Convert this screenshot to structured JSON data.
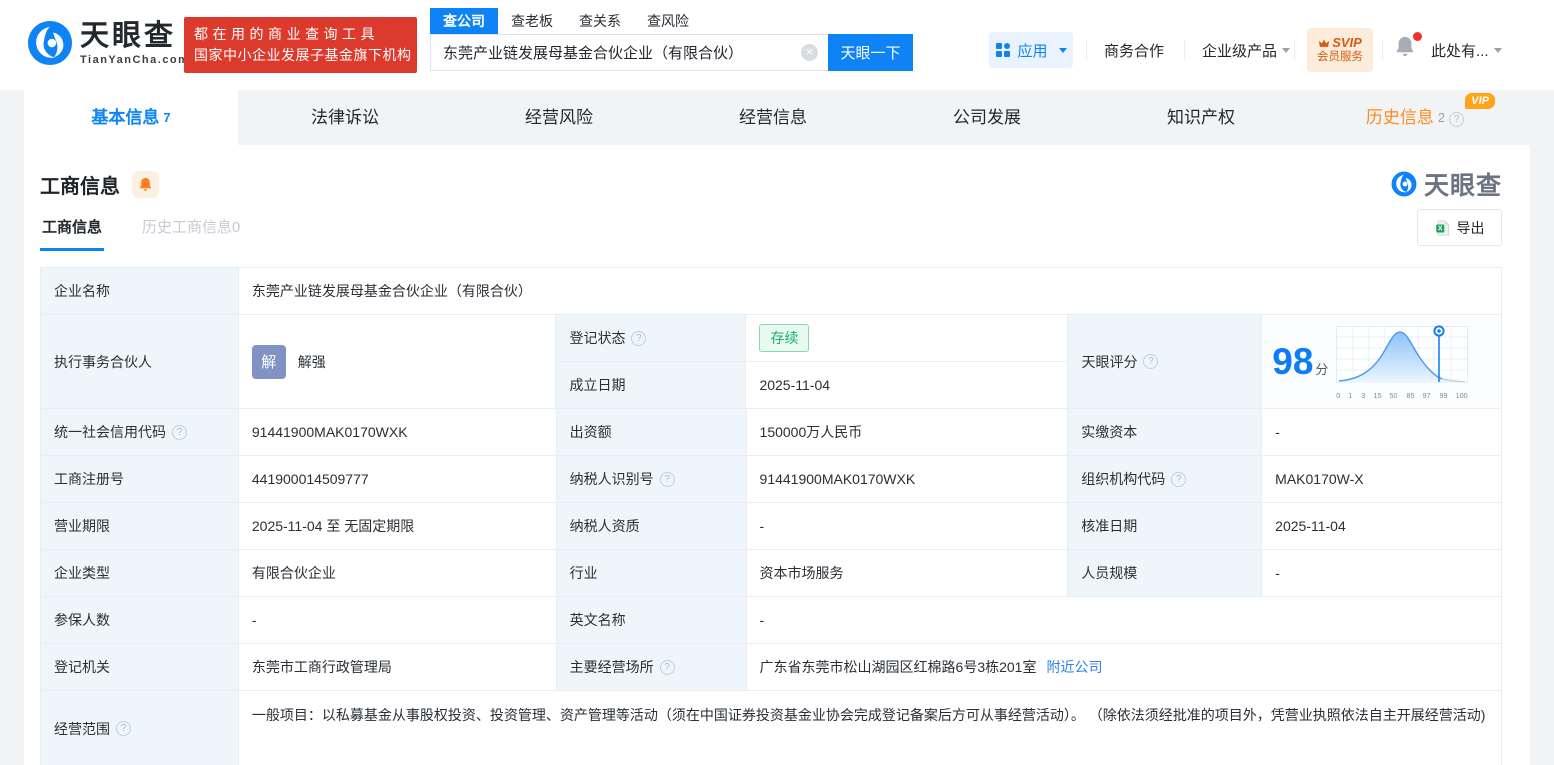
{
  "brand": {
    "name": "天眼查",
    "domain": "TianYanCha.com",
    "slogan_line1": "都在用的商业查询工具",
    "slogan_line2": "国家中小企业发展子基金旗下机构"
  },
  "search": {
    "tabs": [
      {
        "label": "查公司"
      },
      {
        "label": "查老板"
      },
      {
        "label": "查关系"
      },
      {
        "label": "查风险"
      }
    ],
    "value": "东莞产业链发展母基金合伙企业（有限合伙）",
    "button": "天眼一下"
  },
  "nav": {
    "apps": "应用",
    "cooperation": "商务合作",
    "enterprise": "企业级产品",
    "svip_line1": "SVIP",
    "svip_line2": "会员服务",
    "user": "此处有..."
  },
  "tabs": [
    {
      "label": "基本信息",
      "count": "7"
    },
    {
      "label": "法律诉讼"
    },
    {
      "label": "经营风险"
    },
    {
      "label": "经营信息"
    },
    {
      "label": "公司发展"
    },
    {
      "label": "知识产权"
    },
    {
      "label": "历史信息",
      "count": "2",
      "vip": "VIP"
    }
  ],
  "section": {
    "title": "工商信息",
    "watermark": "天眼查",
    "subtab_active": "工商信息",
    "subtab_history": "历史工商信息0",
    "export": "导出"
  },
  "fields": {
    "company_name": {
      "label": "企业名称",
      "value": "东莞产业链发展母基金合伙企业（有限合伙）"
    },
    "partner": {
      "label": "执行事务合伙人",
      "avatar": "解",
      "name": "解强"
    },
    "reg_status": {
      "label": "登记状态",
      "value": "存续"
    },
    "est_date": {
      "label": "成立日期",
      "value": "2025-11-04"
    },
    "tyc_score": {
      "label": "天眼评分"
    },
    "credit_code": {
      "label": "统一社会信用代码",
      "value": "91441900MAK0170WXK"
    },
    "capital": {
      "label": "出资额",
      "value": "150000万人民币"
    },
    "paid_capital": {
      "label": "实缴资本",
      "value": "-"
    },
    "reg_number": {
      "label": "工商注册号",
      "value": "441900014509777"
    },
    "taxpayer_id": {
      "label": "纳税人识别号",
      "value": "91441900MAK0170WXK"
    },
    "org_code": {
      "label": "组织机构代码",
      "value": "MAK0170W-X"
    },
    "business_term": {
      "label": "营业期限",
      "value": "2025-11-04 至 无固定期限"
    },
    "taxpayer_quality": {
      "label": "纳税人资质",
      "value": "-"
    },
    "approval_date": {
      "label": "核准日期",
      "value": "2025-11-04"
    },
    "company_type": {
      "label": "企业类型",
      "value": "有限合伙企业"
    },
    "industry": {
      "label": "行业",
      "value": "资本市场服务"
    },
    "staff_size": {
      "label": "人员规模",
      "value": "-"
    },
    "insured_count": {
      "label": "参保人数",
      "value": "-"
    },
    "english_name": {
      "label": "英文名称",
      "value": "-"
    },
    "reg_authority": {
      "label": "登记机关",
      "value": "东莞市工商行政管理局"
    },
    "business_address": {
      "label": "主要经营场所",
      "value": "广东省东莞市松山湖园区红棉路6号3栋201室",
      "link": "附近公司"
    },
    "business_scope": {
      "label": "经营范围",
      "value": "一般项目：以私募基金从事股权投资、投资管理、资产管理等活动（须在中国证券投资基金业协会完成登记备案后方可从事经营活动）。 （除依法须经批准的项目外，凭营业执照依法自主开展经营活动)"
    }
  },
  "score": {
    "value": "98",
    "unit": "分",
    "ticks": [
      "0",
      "1",
      "3",
      "15",
      "50",
      "85",
      "97",
      "99",
      "100"
    ]
  }
}
